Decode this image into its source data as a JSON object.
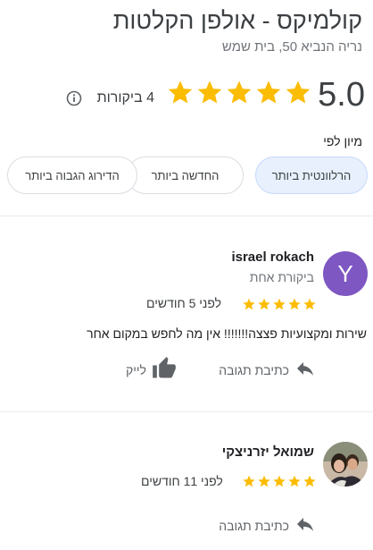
{
  "business": {
    "title": "קולמיקס - אולפן הקלטות",
    "address": "נריה הנביא 50, בית שמש",
    "rating": "5.0",
    "stars": 5,
    "review_count": "4 ביקורות"
  },
  "sort": {
    "label": "מיון לפי",
    "options": [
      {
        "label": "הרלוונטית ביותר",
        "selected": true
      },
      {
        "label": "החדשה ביותר",
        "selected": false
      },
      {
        "label": "הדירוג הגבוה ביותר",
        "selected": false
      }
    ]
  },
  "reviews": [
    {
      "avatar_letter": "Y",
      "name": "israel rokach",
      "subtitle": "ביקורת אחת",
      "stars": 5,
      "date": "לפני 5 חודשים",
      "text": "שירות ומקצועיות פצצה!!!!!!! אין מה לחפש במקום אחר",
      "reply_label": "כתיבת תגובה",
      "like_label": "לייק"
    },
    {
      "name": "שמואל יזרניצקי",
      "stars": 5,
      "date": "לפני 11 חודשים",
      "reply_label": "כתיבת תגובה"
    }
  ],
  "colors": {
    "star": "#fbbc04",
    "avatar_bg": "#7e57c2",
    "chip_selected_bg": "#e8f0fe"
  },
  "icons": [
    "star-icon",
    "info-icon",
    "reply-icon",
    "thumbs-up-icon"
  ]
}
